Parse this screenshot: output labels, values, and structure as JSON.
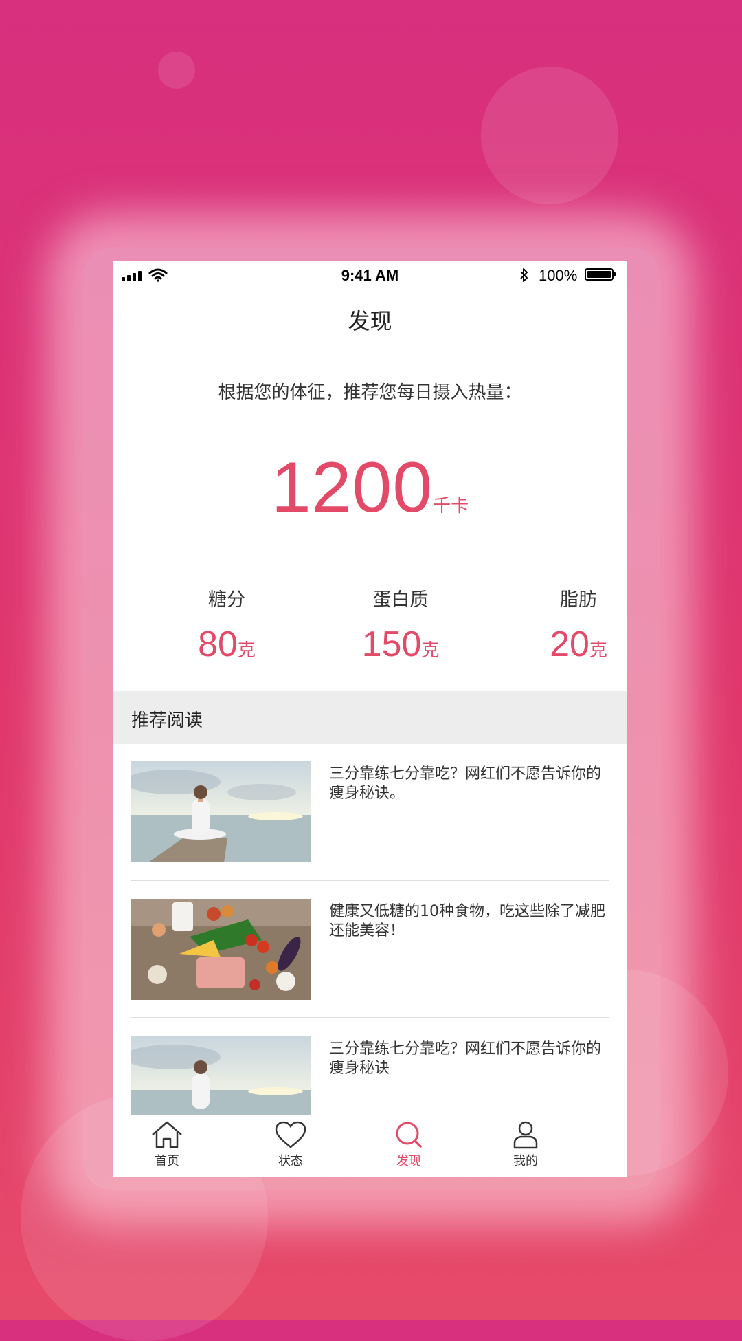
{
  "status_bar": {
    "time": "9:41 AM",
    "battery": "100%"
  },
  "nav": {
    "title": "发现"
  },
  "recommendation": {
    "intro": "根据您的体征，推荐您每日摄入热量：",
    "calories": "1200",
    "calories_unit": "千卡"
  },
  "nutrients": [
    {
      "label": "糖分",
      "value": "80",
      "unit": "克"
    },
    {
      "label": "蛋白质",
      "value": "150",
      "unit": "克"
    },
    {
      "label": "脂肪",
      "value": "20",
      "unit": "克"
    }
  ],
  "reading": {
    "section_title": "推荐阅读",
    "articles": [
      {
        "title": "三分靠练七分靠吃？网红们不愿告诉你的瘦身秘诀。",
        "image": "yoga-meditation-photo"
      },
      {
        "title": "健康又低糖的10种食物，吃这些除了减肥还能美容！",
        "image": "vegetables-food-photo"
      },
      {
        "title": "三分靠练七分靠吃？网红们不愿告诉你的瘦身秘诀",
        "image": "yoga-meditation-photo"
      }
    ]
  },
  "tabs": [
    {
      "label": "首页",
      "icon": "home-icon",
      "active": false
    },
    {
      "label": "状态",
      "icon": "heart-icon",
      "active": false
    },
    {
      "label": "发现",
      "icon": "search-icon",
      "active": true
    },
    {
      "label": "我的",
      "icon": "user-icon",
      "active": false
    }
  ],
  "colors": {
    "accent": "#e24a68",
    "background": "#d82f7e"
  }
}
